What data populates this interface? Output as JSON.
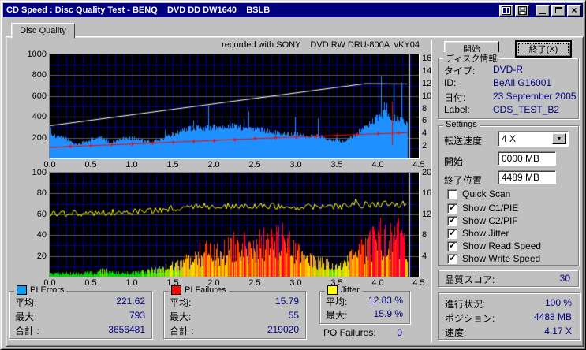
{
  "window": {
    "title": "CD Speed : Disc Quality Test - BENQ    DVD DD DW1640    BSLB"
  },
  "titlebar": {
    "icons": [
      "report-icon",
      "save-icon",
      "minimize-icon",
      "maximize-icon",
      "close-icon"
    ]
  },
  "tab": {
    "label": "Disc Quality"
  },
  "recorded_note": "recorded with SONY    DVD RW DRU-800A  vKY04",
  "buttons": {
    "start": "開始",
    "exit": "終了(X)"
  },
  "disc_info": {
    "legend": "ディスク情報",
    "rows": [
      {
        "label": "タイプ:",
        "value": "DVD-R"
      },
      {
        "label": "ID:",
        "value": "BeAll G16001"
      },
      {
        "label": "日付:",
        "value": "23 September 2005"
      },
      {
        "label": "Label:",
        "value": "CDS_TEST_B2"
      }
    ]
  },
  "settings": {
    "legend": "Settings",
    "speed_label": "転送速度",
    "speed_value": "4 X",
    "start_label": "開始",
    "start_value": "0000 MB",
    "end_label": "終了位置",
    "end_value": "4489 MB",
    "checkboxes": [
      {
        "label": "Quick Scan",
        "checked": false
      },
      {
        "label": "Show C1/PIE",
        "checked": true
      },
      {
        "label": "Show C2/PIF",
        "checked": true
      },
      {
        "label": "Show Jitter",
        "checked": true
      },
      {
        "label": "Show Read Speed",
        "checked": true
      },
      {
        "label": "Show Write Speed",
        "checked": true
      }
    ]
  },
  "quality": {
    "label": "品質スコア:",
    "value": "30"
  },
  "progress": {
    "rows": [
      {
        "label": "進行状況:",
        "value": "100 %"
      },
      {
        "label": "ポジション:",
        "value": "4488 MB"
      },
      {
        "label": "速度:",
        "value": "4.17 X"
      }
    ]
  },
  "stats": {
    "pi_errors": {
      "legend": "PI Errors",
      "swatch": "#00a0ff",
      "rows": [
        {
          "label": "平均:",
          "value": "221.62"
        },
        {
          "label": "最大:",
          "value": "793"
        },
        {
          "label": "合計 :",
          "value": "3656481"
        }
      ]
    },
    "pi_failures": {
      "legend": "PI Failures",
      "swatch": "#ff0000",
      "rows": [
        {
          "label": "平均:",
          "value": "15.79"
        },
        {
          "label": "最大:",
          "value": "55"
        },
        {
          "label": "合計 :",
          "value": "219020"
        }
      ]
    },
    "jitter": {
      "legend": "Jitter",
      "swatch": "#ffff00",
      "rows": [
        {
          "label": "平均:",
          "value": "12.83 %"
        },
        {
          "label": "最大:",
          "value": "15.9 %"
        }
      ]
    },
    "po_failures": {
      "label": "PO Failures:",
      "value": "0"
    }
  },
  "chart_data": [
    {
      "type": "area",
      "title": "PI Errors with Read/Write speed overlay",
      "bg": "#000000",
      "grid_blue": "#0000a0",
      "grid_gray": "#5a5a5a",
      "x_range": [
        0,
        4.5
      ],
      "data_end_x": 4.365,
      "end_marker_x": 4.373,
      "x_tick_labels": [
        "0.0",
        "0.5",
        "1.0",
        "1.5",
        "2.0",
        "2.5",
        "3.0",
        "3.5",
        "4.0",
        "4.5"
      ],
      "left_axis": {
        "range": [
          0,
          1000
        ],
        "ticks": [
          1000,
          800,
          600,
          400,
          200
        ]
      },
      "right_axis": {
        "range": [
          0,
          16.67
        ],
        "ticks": [
          16,
          14,
          12,
          10,
          8,
          6,
          4,
          2
        ]
      },
      "pi_errors_area": {
        "color": "#1e90ff",
        "envelope": [
          [
            0,
            295
          ],
          [
            0.03,
            230
          ],
          [
            0.08,
            200
          ],
          [
            0.15,
            205
          ],
          [
            0.2,
            190
          ],
          [
            0.25,
            165
          ],
          [
            0.3,
            142
          ],
          [
            0.35,
            138
          ],
          [
            0.42,
            155
          ],
          [
            0.5,
            180
          ],
          [
            0.55,
            193
          ],
          [
            0.6,
            200
          ],
          [
            0.65,
            188
          ],
          [
            0.7,
            168
          ],
          [
            0.75,
            148
          ],
          [
            0.8,
            172
          ],
          [
            0.9,
            195
          ],
          [
            1.0,
            198
          ],
          [
            1.1,
            182
          ],
          [
            1.15,
            162
          ],
          [
            1.25,
            160
          ],
          [
            1.35,
            185
          ],
          [
            1.45,
            215
          ],
          [
            1.55,
            248
          ],
          [
            1.65,
            278
          ],
          [
            1.75,
            295
          ],
          [
            1.85,
            292
          ],
          [
            1.95,
            298
          ],
          [
            2.05,
            298
          ],
          [
            2.15,
            308
          ],
          [
            2.25,
            318
          ],
          [
            2.32,
            298
          ],
          [
            2.4,
            282
          ],
          [
            2.5,
            282
          ],
          [
            2.6,
            272
          ],
          [
            2.7,
            262
          ],
          [
            2.8,
            247
          ],
          [
            2.9,
            232
          ],
          [
            3.0,
            248
          ],
          [
            3.1,
            222
          ],
          [
            3.2,
            212
          ],
          [
            3.3,
            215
          ],
          [
            3.4,
            188
          ],
          [
            3.5,
            167
          ],
          [
            3.6,
            170
          ],
          [
            3.7,
            218
          ],
          [
            3.8,
            278
          ],
          [
            3.9,
            338
          ],
          [
            4.0,
            398
          ],
          [
            4.05,
            432
          ],
          [
            4.1,
            422
          ],
          [
            4.2,
            392
          ],
          [
            4.3,
            362
          ],
          [
            4.36,
            330
          ]
        ],
        "spikes": [
          [
            1.93,
            508
          ],
          [
            2.42,
            452
          ],
          [
            2.99,
            398
          ],
          [
            3.27,
            385
          ],
          [
            4.04,
            790
          ],
          [
            4.19,
            728
          ],
          [
            4.29,
            728
          ]
        ]
      },
      "write_speed_line": {
        "color": "#ffffff",
        "axis": "right",
        "points": [
          [
            0,
            5.3
          ],
          [
            3.85,
            12.05
          ],
          [
            4.36,
            12.0
          ]
        ]
      },
      "read_speed_line": {
        "color": "#ff0000",
        "axis": "right",
        "points": [
          [
            0,
            1.83
          ],
          [
            1.0,
            2.38
          ],
          [
            2.0,
            2.95
          ],
          [
            3.0,
            3.5
          ],
          [
            3.85,
            3.95
          ],
          [
            4.36,
            4.18
          ]
        ],
        "spike": {
          "x": 4.17,
          "from": 2.2,
          "to": 9.1
        }
      },
      "end_marker_color": "#bdbdbd"
    },
    {
      "type": "bar",
      "title": "PI Failures with Jitter overlay",
      "bg": "#000000",
      "grid_blue": "#0000a0",
      "grid_gray": "#5a5a5a",
      "x_range": [
        0,
        4.5
      ],
      "data_end_x": 4.365,
      "end_marker_x": 4.373,
      "x_tick_labels": [
        "0.0",
        "0.5",
        "1.0",
        "1.5",
        "2.0",
        "2.5",
        "3.0",
        "3.5",
        "4.0",
        "4.5"
      ],
      "left_axis": {
        "range": [
          0,
          100
        ],
        "ticks": [
          100,
          80,
          60,
          40,
          20
        ]
      },
      "right_axis": {
        "range": [
          0,
          20
        ],
        "ticks": [
          20,
          16,
          12,
          8,
          4
        ]
      },
      "pi_failures_bars": {
        "envelope": [
          [
            0,
            4.5
          ],
          [
            0.2,
            4
          ],
          [
            0.4,
            4.5
          ],
          [
            0.6,
            6.5
          ],
          [
            0.65,
            9
          ],
          [
            0.75,
            5.5
          ],
          [
            0.9,
            5
          ],
          [
            1.05,
            5.5
          ],
          [
            1.2,
            7
          ],
          [
            1.35,
            10
          ],
          [
            1.5,
            14
          ],
          [
            1.6,
            19
          ],
          [
            1.7,
            24
          ],
          [
            1.8,
            28
          ],
          [
            1.9,
            31
          ],
          [
            2.0,
            31
          ],
          [
            2.1,
            33
          ],
          [
            2.2,
            37
          ],
          [
            2.3,
            39
          ],
          [
            2.4,
            39
          ],
          [
            2.5,
            43
          ],
          [
            2.6,
            46
          ],
          [
            2.7,
            45
          ],
          [
            2.78,
            52
          ],
          [
            2.82,
            55
          ],
          [
            2.9,
            40
          ],
          [
            3.0,
            33
          ],
          [
            3.1,
            25
          ],
          [
            3.2,
            22
          ],
          [
            3.3,
            19
          ],
          [
            3.4,
            16
          ],
          [
            3.5,
            14
          ],
          [
            3.6,
            17
          ],
          [
            3.7,
            28
          ],
          [
            3.8,
            37
          ],
          [
            3.9,
            45
          ],
          [
            4.0,
            50
          ],
          [
            4.1,
            52
          ],
          [
            4.2,
            52
          ],
          [
            4.3,
            48
          ],
          [
            4.36,
            42
          ]
        ],
        "color_thresholds": [
          6,
          10,
          15,
          21,
          28,
          38
        ],
        "colors": [
          "#00d800",
          "#86e000",
          "#e8e800",
          "#ffc000",
          "#ff8000",
          "#ff3800",
          "#ff0030"
        ]
      },
      "jitter_line": {
        "color": "#ffff00",
        "axis": "left",
        "noise": 3.2,
        "envelope": [
          [
            0,
            61
          ],
          [
            0.3,
            60.5
          ],
          [
            0.6,
            61.5
          ],
          [
            0.9,
            62
          ],
          [
            1.1,
            63
          ],
          [
            1.3,
            64
          ],
          [
            1.5,
            66
          ],
          [
            1.8,
            67.5
          ],
          [
            2.1,
            68
          ],
          [
            2.4,
            68.5
          ],
          [
            2.7,
            68
          ],
          [
            3.0,
            67
          ],
          [
            3.3,
            67.5
          ],
          [
            3.6,
            68
          ],
          [
            3.9,
            69.5
          ],
          [
            4.15,
            70
          ],
          [
            4.36,
            69.5
          ]
        ]
      },
      "end_marker_color": "#bdbdbd"
    }
  ]
}
